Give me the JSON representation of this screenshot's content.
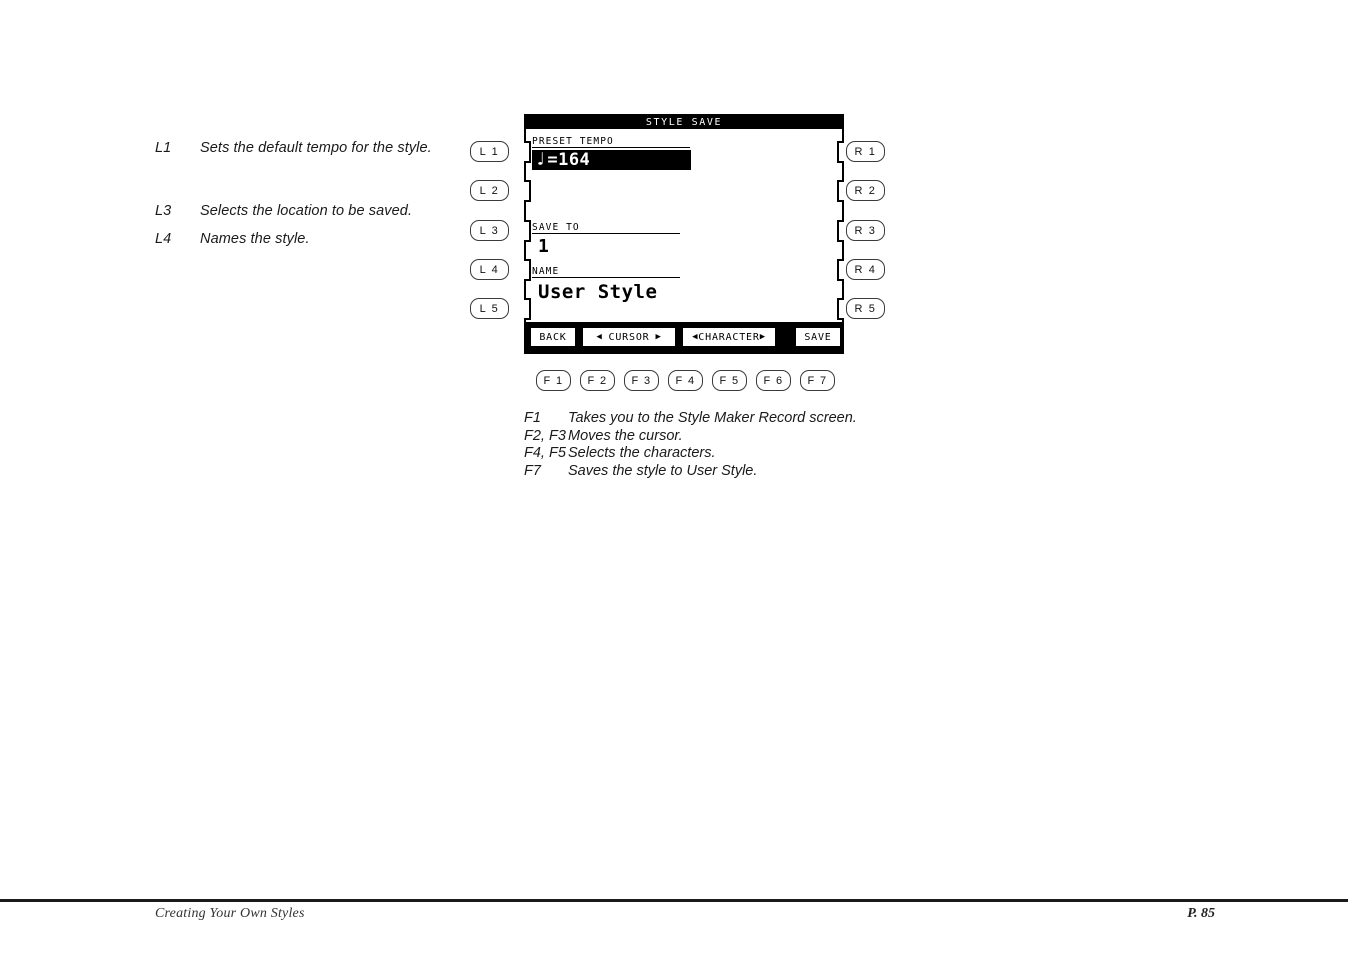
{
  "left_notes": [
    {
      "key": "L1",
      "text": "Sets the default tempo for the style."
    },
    {
      "key": "L3",
      "text": "Selects the location to be saved."
    },
    {
      "key": "L4",
      "text": "Names the style."
    }
  ],
  "left_buttons": [
    {
      "label": "L 1"
    },
    {
      "label": "L 2"
    },
    {
      "label": "L 3"
    },
    {
      "label": "L 4"
    },
    {
      "label": "L 5"
    }
  ],
  "right_buttons": [
    {
      "label": "R 1"
    },
    {
      "label": "R 2"
    },
    {
      "label": "R 3"
    },
    {
      "label": "R 4"
    },
    {
      "label": "R 5"
    }
  ],
  "lcd": {
    "title": "STYLE SAVE",
    "fields": {
      "preset_tempo": {
        "label": "PRESET TEMPO",
        "note_glyph": "♩",
        "value": "=164",
        "highlighted": true
      },
      "save_to": {
        "label": "SAVE TO",
        "value": "1"
      },
      "name": {
        "label": "NAME",
        "value": "User Style"
      }
    },
    "soft_keys": [
      {
        "id": "back",
        "label": "BACK"
      },
      {
        "id": "cursor",
        "label": "CURSOR",
        "left_arrow": "◀",
        "right_arrow": "▶"
      },
      {
        "id": "character",
        "label": "CHARACTER",
        "left_arrow": "◀",
        "right_arrow": "▶"
      },
      {
        "id": "save",
        "label": "SAVE"
      }
    ]
  },
  "f_buttons": [
    {
      "label": "F 1"
    },
    {
      "label": "F 2"
    },
    {
      "label": "F 3"
    },
    {
      "label": "F 4"
    },
    {
      "label": "F 5"
    },
    {
      "label": "F 6"
    },
    {
      "label": "F 7"
    }
  ],
  "f_notes": [
    {
      "key": "F1",
      "text": "Takes you to the Style Maker Record screen."
    },
    {
      "key": "F2, F3",
      "text": "Moves the cursor."
    },
    {
      "key": "F4, F5",
      "text": "Selects the characters."
    },
    {
      "key": "F7",
      "text": "Saves the style to User Style."
    }
  ],
  "footer": {
    "section": "Creating Your Own Styles",
    "page": "P. 85"
  }
}
